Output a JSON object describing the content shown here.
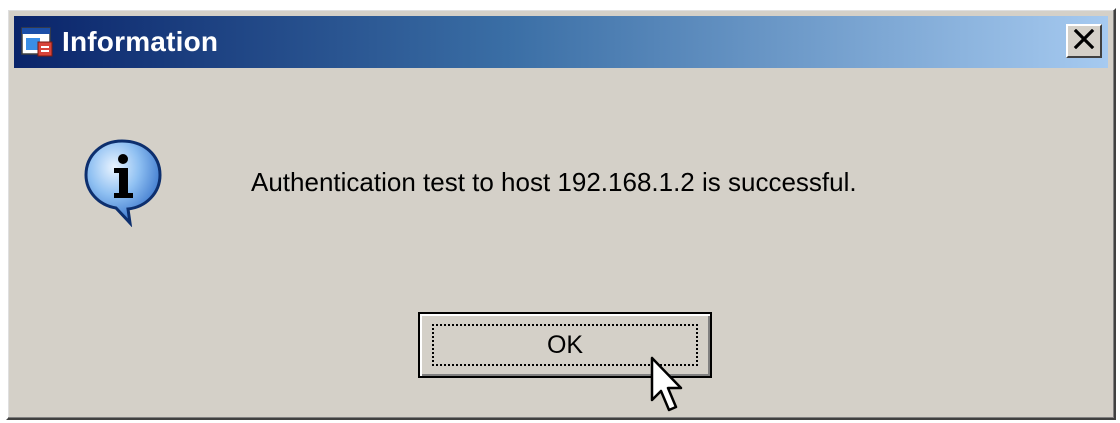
{
  "window": {
    "title": "Information",
    "icon": "app-window-icon",
    "close_label": "X",
    "close_icon": "close-icon"
  },
  "content": {
    "icon": "info-icon",
    "message": "Authentication test to host 192.168.1.2 is successful."
  },
  "actions": {
    "ok_label": "OK"
  },
  "colors": {
    "face": "#d4d0c8",
    "title_start": "#0a246a",
    "title_end": "#a6caf0",
    "info_blue": "#3a7bd5"
  }
}
